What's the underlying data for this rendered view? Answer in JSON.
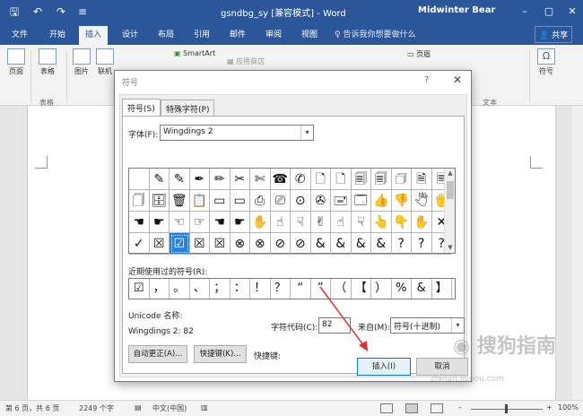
{
  "titlebar": {
    "title": "gsndbg_sy [兼容模式] - Word",
    "user": "Midwinter Bear",
    "icons": [
      "save-icon",
      "undo-icon",
      "redo-icon",
      "customize-icon"
    ]
  },
  "tabs": {
    "items": [
      "文件",
      "开始",
      "插入",
      "设计",
      "布局",
      "引用",
      "邮件",
      "审阅",
      "视图"
    ],
    "active": "插入",
    "tellme": "♀ 告诉我你想要做什么",
    "share": "共享"
  },
  "ribbon": {
    "page_label": "页面",
    "table_label": "表格",
    "pictures_label": "图片",
    "online_label": "联机",
    "smartart_label": "SmartArt",
    "store_label": "应用商店",
    "header_label": "页眉",
    "text_label": "文本",
    "symbol_label": "符号",
    "group_table": "表格"
  },
  "dialog": {
    "title": "符号",
    "help": "?",
    "close": "✕",
    "tabs": [
      "符号(S)",
      "特殊字符(P)"
    ],
    "font_label": "字体(F):",
    "font_value": "Wingdings 2",
    "grid_rows": [
      [
        "",
        "✎",
        "✎",
        "✒",
        "✏",
        "✂",
        "✄",
        "☎",
        "✆",
        "🗋",
        "🗋",
        "🗐",
        "🗐",
        "🗇",
        "🗎",
        "🗏"
      ],
      [
        "🗍",
        "🗄",
        "🗑",
        "📋",
        "▭",
        "▭",
        "⎙",
        "⎚",
        "⊙",
        "✇",
        "🖃",
        "🗔",
        "👍",
        "👎",
        "🖑",
        "🖐"
      ],
      [
        "☚",
        "☛",
        "☜",
        "☞",
        "☚",
        "☛",
        "✋",
        "☝",
        "☟",
        "✌",
        "☝",
        "☟",
        "👆",
        "👇",
        "✋",
        "✕"
      ],
      [
        "✓",
        "☒",
        "☑",
        "☒",
        "☒",
        "⊗",
        "⊗",
        "⊘",
        "⊘",
        "&",
        "&",
        "&",
        "&",
        "?",
        "?",
        "?"
      ]
    ],
    "recent_label": "近期使用过的符号(R):",
    "recent": [
      "☑",
      "，",
      "。",
      "、",
      "；",
      "：",
      "！",
      "？",
      "“",
      "”",
      "（",
      "【",
      "）",
      "%",
      "&",
      "】"
    ],
    "unicode_name_label": "Unicode 名称:",
    "char_name": "Wingdings 2: 82",
    "char_code_label": "字符代码(C):",
    "char_code": "82",
    "from_label": "来自(M):",
    "from_value": "符号(十进制)",
    "autocorrect_btn": "自动更正(A)...",
    "shortcut_btn": "快捷键(K)...",
    "shortcut_label": "快捷键:",
    "insert_btn": "插入(I)",
    "cancel_btn": "取消"
  },
  "statusbar": {
    "page": "第 6 页，共 6 页",
    "words": "2249 个字",
    "lang": "中文(中国)",
    "zoom": "100%"
  },
  "watermark": {
    "text": "搜狗指南",
    "url": "zhinan.sogou.com"
  },
  "colors": {
    "word_blue": "#2b579a",
    "selection_blue": "#2b7fd8",
    "annotation_red": "#e03030"
  }
}
